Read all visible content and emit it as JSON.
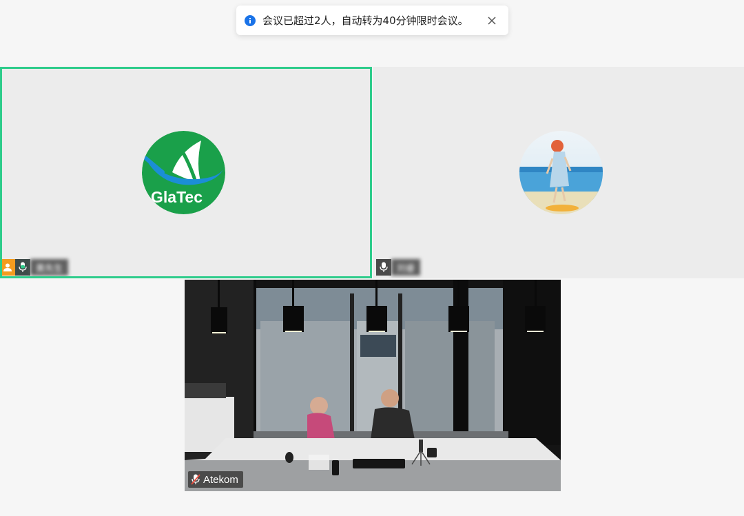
{
  "toast": {
    "icon": "info-icon",
    "message": "会议已超过2人，自动转为40分钟限时会议。",
    "close_icon": "close-icon",
    "accent_color": "#1a73e8"
  },
  "participants": [
    {
      "name": "黄先生",
      "name_blurred": true,
      "is_host": true,
      "mic": "on",
      "active_speaker": true,
      "avatar_logo_text": "GlaTec",
      "highlight_color": "#2ecc8b"
    },
    {
      "name": "刘睿",
      "name_blurred": true,
      "is_host": false,
      "mic": "on",
      "active_speaker": false,
      "avatar": "painted-girl-at-beach"
    },
    {
      "name": "Atekom",
      "name_blurred": false,
      "is_host": false,
      "mic": "muted",
      "video": "on"
    }
  ]
}
